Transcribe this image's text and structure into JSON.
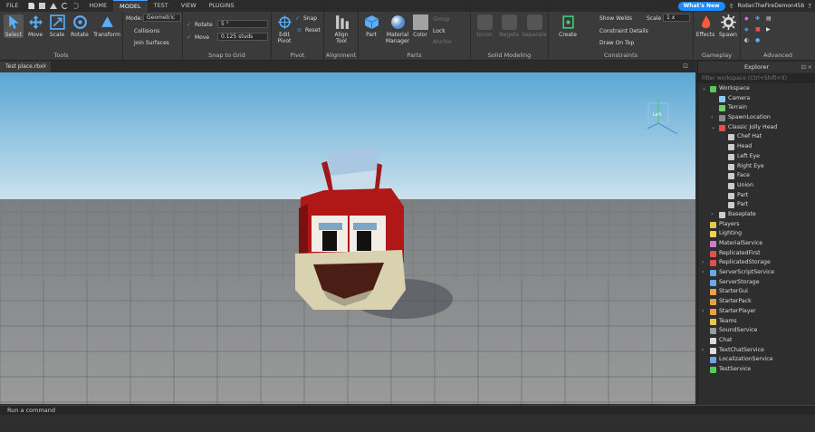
{
  "menubar": {
    "file": "FILE",
    "tabs": [
      "HOME",
      "MODEL",
      "TEST",
      "VIEW",
      "PLUGINS"
    ],
    "active_tab": "MODEL",
    "whats_new": "What's New",
    "username": "RodanTheFireDemon45b"
  },
  "ribbon": {
    "tools": {
      "select": "Select",
      "move": "Move",
      "scale": "Scale",
      "rotate": "Rotate",
      "transform": "Transform",
      "label": "Tools"
    },
    "mode": {
      "label": "Mode:",
      "value": "Geometric",
      "collisions": "Collisions",
      "join_surfaces": "Join Surfaces"
    },
    "snap": {
      "rotate_label": "Rotate",
      "rotate_value": "5 °",
      "move_label": "Move",
      "move_value": "0.125 studs",
      "label": "Snap to Grid"
    },
    "pivot": {
      "edit": "Edit\nPivot",
      "snap": "Snap",
      "reset": "Reset",
      "label": "Pivot"
    },
    "alignment": {
      "align": "Align\nTool",
      "label": "Alignment"
    },
    "parts": {
      "part": "Part",
      "material": "Material\nManager",
      "color": "Color",
      "group": "Group",
      "lock": "Lock",
      "anchor": "Anchor",
      "label": "Parts"
    },
    "solid": {
      "union": "Union",
      "negate": "Negate",
      "separate": "Separate",
      "label": "Solid Modeling"
    },
    "constraints": {
      "create": "Create",
      "show_welds": "Show Welds",
      "constraint_details": "Constraint Details",
      "draw_on_top": "Draw On Top",
      "scale_label": "Scale",
      "scale_value": "1 x",
      "label": "Constraints"
    },
    "gameplay": {
      "effects": "Effects",
      "spawn": "Spawn",
      "label": "Gameplay"
    },
    "advanced": {
      "label": "Advanced"
    }
  },
  "doc_tab": {
    "title": "Test place.rbxl"
  },
  "viewport": {
    "sky_top": "#5aa7d4",
    "sky_bottom": "#cfe4ee",
    "ground": "#8a8a8a",
    "view_cube_label": "Left"
  },
  "explorer": {
    "title": "Explorer",
    "filter_placeholder": "Filter workspace (Ctrl+Shift+X)",
    "items": [
      {
        "label": "Workspace",
        "depth": 0,
        "arrow": "⌄",
        "color": "#5bc85b"
      },
      {
        "label": "Camera",
        "depth": 1,
        "arrow": "",
        "color": "#8cc7ff"
      },
      {
        "label": "Terrain",
        "depth": 1,
        "arrow": "",
        "color": "#6ccf6c"
      },
      {
        "label": "SpawnLocation",
        "depth": 1,
        "arrow": "›",
        "color": "#8a8a8a"
      },
      {
        "label": "Classic Jolly Head",
        "depth": 1,
        "arrow": "⌄",
        "color": "#e05050"
      },
      {
        "label": "Chef Hat",
        "depth": 2,
        "arrow": "",
        "color": "#cccccc"
      },
      {
        "label": "Head",
        "depth": 2,
        "arrow": "",
        "color": "#cccccc"
      },
      {
        "label": "Left Eye",
        "depth": 2,
        "arrow": "",
        "color": "#cccccc"
      },
      {
        "label": "Right Eye",
        "depth": 2,
        "arrow": "",
        "color": "#cccccc"
      },
      {
        "label": "Face",
        "depth": 2,
        "arrow": "",
        "color": "#cccccc"
      },
      {
        "label": "Union",
        "depth": 2,
        "arrow": "",
        "color": "#cccccc"
      },
      {
        "label": "Part",
        "depth": 2,
        "arrow": "",
        "color": "#cccccc"
      },
      {
        "label": "Part",
        "depth": 2,
        "arrow": "",
        "color": "#cccccc"
      },
      {
        "label": "Baseplate",
        "depth": 1,
        "arrow": "›",
        "color": "#cccccc"
      },
      {
        "label": "Players",
        "depth": 0,
        "arrow": "",
        "color": "#e8c84a"
      },
      {
        "label": "Lighting",
        "depth": 0,
        "arrow": "",
        "color": "#f2d24a"
      },
      {
        "label": "MaterialService",
        "depth": 0,
        "arrow": "",
        "color": "#d07ad0"
      },
      {
        "label": "ReplicatedFirst",
        "depth": 0,
        "arrow": "",
        "color": "#e05050"
      },
      {
        "label": "ReplicatedStorage",
        "depth": 0,
        "arrow": "›",
        "color": "#e05050"
      },
      {
        "label": "ServerScriptService",
        "depth": 0,
        "arrow": "›",
        "color": "#6aa6e8"
      },
      {
        "label": "ServerStorage",
        "depth": 0,
        "arrow": "",
        "color": "#6aa6e8"
      },
      {
        "label": "StarterGui",
        "depth": 0,
        "arrow": "",
        "color": "#e8a040"
      },
      {
        "label": "StarterPack",
        "depth": 0,
        "arrow": "",
        "color": "#e8a040"
      },
      {
        "label": "StarterPlayer",
        "depth": 0,
        "arrow": "›",
        "color": "#e8a040"
      },
      {
        "label": "Teams",
        "depth": 0,
        "arrow": "",
        "color": "#e8c84a"
      },
      {
        "label": "SoundService",
        "depth": 0,
        "arrow": "",
        "color": "#9a9a9a"
      },
      {
        "label": "Chat",
        "depth": 0,
        "arrow": "",
        "color": "#dddddd"
      },
      {
        "label": "TextChatService",
        "depth": 0,
        "arrow": "›",
        "color": "#dddddd"
      },
      {
        "label": "LocalizationService",
        "depth": 0,
        "arrow": "",
        "color": "#6aa6e8"
      },
      {
        "label": "TestService",
        "depth": 0,
        "arrow": "",
        "color": "#5bc85b"
      }
    ]
  },
  "command_bar": {
    "placeholder": "Run a command"
  }
}
